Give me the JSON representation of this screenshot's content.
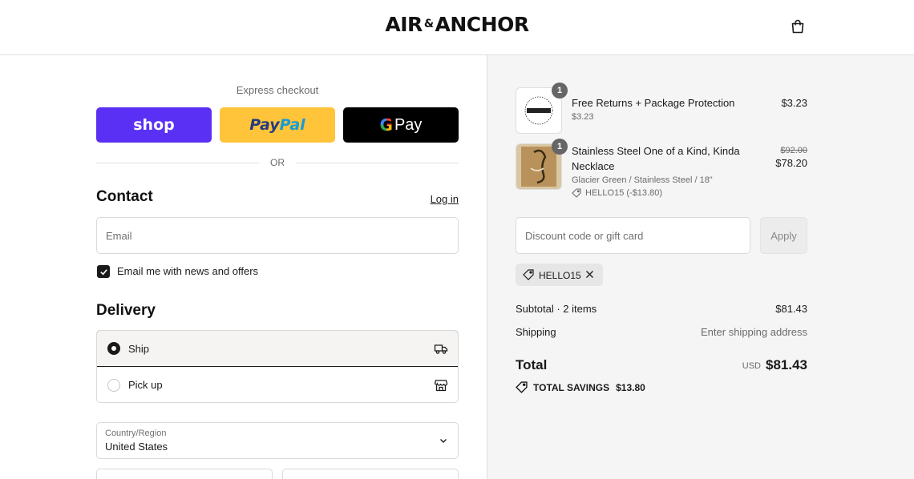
{
  "header": {
    "logo_left": "AIR",
    "logo_amp": "&",
    "logo_right": "ANCHOR"
  },
  "express": {
    "label": "Express checkout",
    "shop_label": "shop",
    "paypal_label_a": "Pay",
    "paypal_label_b": "Pal",
    "gpay_g": "G",
    "gpay_label": "Pay",
    "or_label": "OR"
  },
  "contact": {
    "title": "Contact",
    "login_label": "Log in",
    "email_placeholder": "Email",
    "newsletter_label": "Email me with news and offers",
    "newsletter_checked": true
  },
  "delivery": {
    "title": "Delivery",
    "options": [
      {
        "label": "Ship",
        "selected": true,
        "icon": "truck-icon"
      },
      {
        "label": "Pick up",
        "selected": false,
        "icon": "store-icon"
      }
    ],
    "country_label": "Country/Region",
    "country_value": "United States"
  },
  "cart": {
    "items": [
      {
        "title": "Free Returns + Package Protection",
        "subtitle": "$3.23",
        "quantity": "1",
        "price": "$3.23"
      },
      {
        "title": "Stainless Steel One of a Kind, Kinda Necklace",
        "variant": "Glacier Green / Stainless Steel / 18\"",
        "discount": "HELLO15 (-$13.80)",
        "quantity": "1",
        "original_price": "$92.00",
        "price": "$78.20"
      }
    ],
    "discount_placeholder": "Discount code or gift card",
    "apply_label": "Apply",
    "applied_code": "HELLO15",
    "subtotal_label": "Subtotal · 2 items",
    "subtotal_value": "$81.43",
    "shipping_label": "Shipping",
    "shipping_value": "Enter shipping address",
    "total_label": "Total",
    "currency": "USD",
    "total_value": "$81.43",
    "savings_label": "TOTAL SAVINGS",
    "savings_value": "$13.80"
  },
  "colors": {
    "shop": "#5a31f4",
    "paypal": "#ffc439",
    "gpay": "#000000",
    "summary_bg": "#f5f5f5"
  }
}
